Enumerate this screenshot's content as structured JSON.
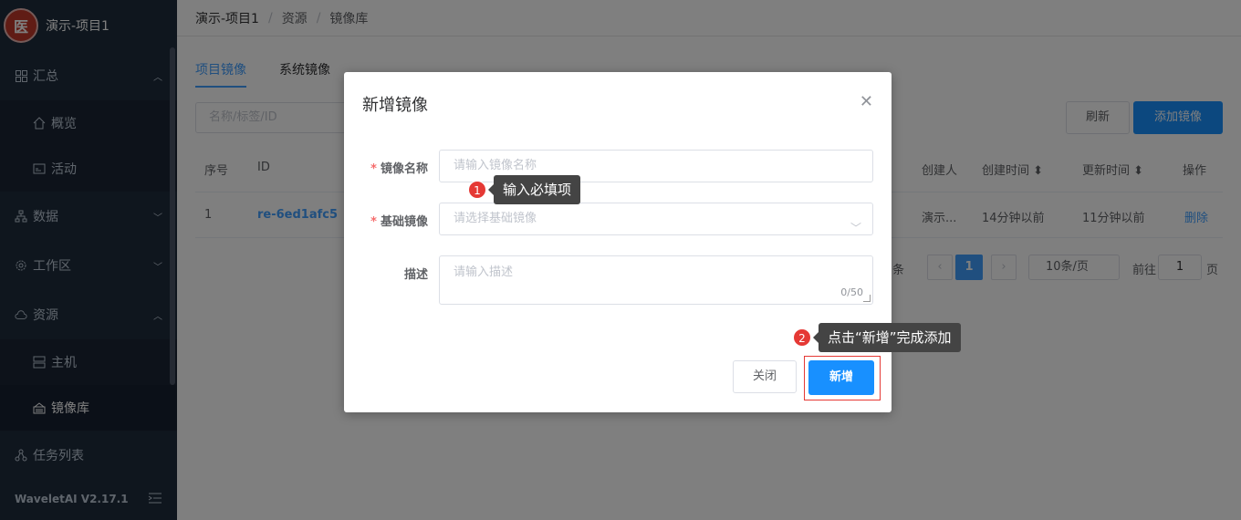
{
  "app": {
    "project_title": "演示-项目1",
    "version": "WaveletAI V2.17.1",
    "logo_text": "医"
  },
  "sidebar": {
    "items": [
      {
        "label": "汇总",
        "icon": "grid-icon"
      },
      {
        "label": "概览",
        "icon": "home-icon"
      },
      {
        "label": "活动",
        "icon": "activity-icon"
      },
      {
        "label": "数据",
        "icon": "hierarchy-icon"
      },
      {
        "label": "工作区",
        "icon": "gear-icon"
      },
      {
        "label": "资源",
        "icon": "cloud-icon"
      },
      {
        "label": "主机",
        "icon": "server-icon"
      },
      {
        "label": "镜像库",
        "icon": "image-store-icon"
      },
      {
        "label": "任务列表",
        "icon": "share-icon"
      }
    ]
  },
  "breadcrumb": {
    "items": [
      "演示-项目1",
      "资源",
      "镜像库"
    ],
    "separator": "/"
  },
  "tabs": [
    {
      "label": "项目镜像"
    },
    {
      "label": "系统镜像"
    }
  ],
  "toolbar": {
    "search_placeholder": "名称/标签/ID",
    "refresh_label": "刷新",
    "add_label": "添加镜像"
  },
  "table": {
    "headers": {
      "index": "序号",
      "id": "ID",
      "creator": "创建人",
      "created": "创建时间",
      "updated": "更新时间",
      "ops": "操作"
    },
    "rows": [
      {
        "index": "1",
        "id": "re-6ed1afc5",
        "creator": "演示...",
        "created": "14分钟以前",
        "updated": "11分钟以前",
        "op": "删除"
      }
    ]
  },
  "pagination": {
    "total_suffix": "条",
    "current_page": "1",
    "page_size": "10条/页",
    "goto_prefix": "前往",
    "goto_value": "1",
    "goto_suffix": "页"
  },
  "modal": {
    "title": "新增镜像",
    "fields": {
      "name": {
        "label": "镜像名称",
        "placeholder": "请输入镜像名称",
        "required": "*"
      },
      "base": {
        "label": "基础镜像",
        "placeholder": "请选择基础镜像",
        "required": "*"
      },
      "desc": {
        "label": "描述",
        "placeholder": "请输入描述",
        "counter": "0/50"
      }
    },
    "cancel_label": "关闭",
    "confirm_label": "新增"
  },
  "tips": [
    {
      "num": "1",
      "text": "输入必填项"
    },
    {
      "num": "2",
      "text": "点击“新增”完成添加"
    }
  ],
  "colors": {
    "primary": "#1890ff",
    "sidebar_bg": "#1f2d3d",
    "highlight": "#e53935"
  }
}
